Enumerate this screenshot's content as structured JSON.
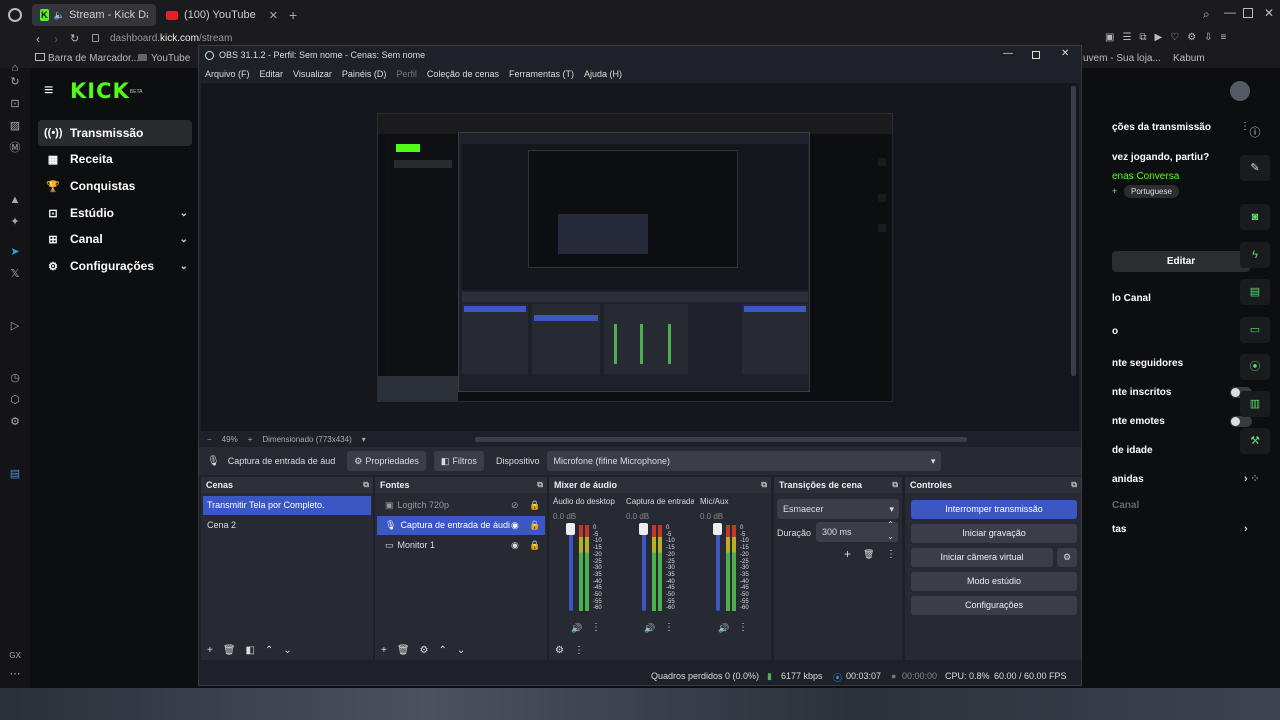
{
  "browser": {
    "tabs": [
      {
        "label": "Stream - Kick Dashbo"
      },
      {
        "label": "(100) YouTube"
      }
    ],
    "url_prefix": "dashboard.",
    "url_domain": "kick.com",
    "url_path": "/stream",
    "bookmarks": [
      "Barra de Marcador...",
      "YouTube"
    ],
    "bookmarks_right": [
      "uvem - Sua loja...",
      "Kabum"
    ],
    "rail_labels": {
      "gx": "GX"
    }
  },
  "kick": {
    "logo": "KICK",
    "logo_sup": "BETA",
    "nav": [
      {
        "label": "Transmissão",
        "icon": "((•))"
      },
      {
        "label": "Receita",
        "icon": "▦"
      },
      {
        "label": "Conquistas",
        "icon": "🏆"
      },
      {
        "label": "Estúdio",
        "icon": "⊡"
      },
      {
        "label": "Canal",
        "icon": "⊞"
      },
      {
        "label": "Configurações",
        "icon": "⚙"
      }
    ],
    "right_panel": {
      "stream_info_title": "ções da transmissão",
      "question": "vez jogando, partiu?",
      "category": "enas Conversa",
      "language": "Portuguese",
      "edit_button": "Editar",
      "channel_title": "lo Canal",
      "rows": [
        {
          "label": "nte seguidores",
          "control": "chevron"
        },
        {
          "label": "nte inscritos",
          "control": "toggle"
        },
        {
          "label": "nte emotes",
          "control": "toggle"
        },
        {
          "label": "de idade",
          "control": "chevron"
        },
        {
          "label": "anidas",
          "control": "chevron"
        },
        {
          "label": "Canal",
          "control": "none"
        },
        {
          "label": "tas",
          "control": "chevron"
        }
      ]
    }
  },
  "obs": {
    "title": "OBS 31.1.2 - Perfil: Sem nome - Cenas: Sem nome",
    "menu": [
      "Arquivo (F)",
      "Editar",
      "Visualizar",
      "Painéis (D)",
      "Perfil",
      "Coleção de cenas",
      "Ferramentas (T)",
      "Ajuda (H)"
    ],
    "zoom": {
      "minus": "−",
      "value": "49%",
      "plus": "+",
      "scaled": "Dimensionado (773x434)"
    },
    "context": {
      "source": "Captura de entrada de áud",
      "properties": "Propriedades",
      "filters": "Filtros",
      "device_label": "Dispositivo",
      "device_value": "Microfone (fifine Microphone)"
    },
    "scenes": {
      "title": "Cenas",
      "items": [
        "Transmitir Tela por Completo.",
        "Cena 2"
      ]
    },
    "sources": {
      "title": "Fontes",
      "items": [
        {
          "label": "Logitch 720p"
        },
        {
          "label": "Captura de entrada de áudi"
        },
        {
          "label": "Monitor 1"
        }
      ]
    },
    "mixer": {
      "title": "Mixer de áudio",
      "channels": [
        {
          "name": "Áudio do desktop",
          "db": "0.0 dB"
        },
        {
          "name": "Captura de entrada",
          "db": "0.0 dB"
        },
        {
          "name": "Mic/Aux",
          "db": "0.0 dB"
        }
      ],
      "ticks": [
        "0",
        "-5",
        "-10",
        "-15",
        "-20",
        "-25",
        "-30",
        "-35",
        "-40",
        "-45",
        "-50",
        "-55",
        "-60"
      ]
    },
    "transitions": {
      "title": "Transições de cena",
      "selected": "Esmaecer",
      "duration_label": "Duração",
      "duration_value": "300 ms"
    },
    "controls": {
      "title": "Controles",
      "buttons": [
        "Interromper transmissão",
        "Iniciar gravação",
        "Iniciar câmera virtual",
        "Modo estúdio",
        "Configurações"
      ]
    },
    "status": {
      "dropped": "Quadros perdidos 0 (0.0%)",
      "bitrate": "6177 kbps",
      "stream_time": "00:03:07",
      "rec_time": "00:00:00",
      "cpu": "CPU: 0.8%",
      "fps": "60.00 / 60.00 FPS"
    }
  },
  "colors": {
    "kick_green": "#53fc18",
    "obs_accent": "#3a57c4",
    "meter_green": "#4caf50",
    "meter_yellow": "#b8b020",
    "meter_red": "#c0392b"
  }
}
